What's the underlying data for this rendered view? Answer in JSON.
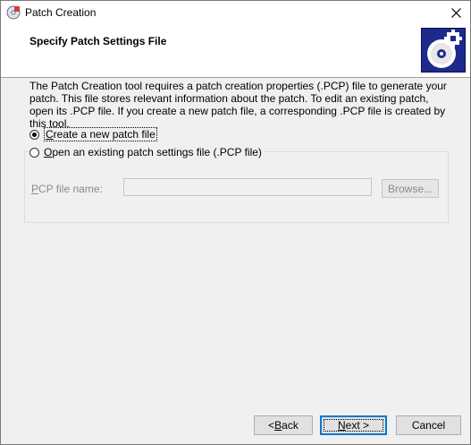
{
  "window": {
    "title": "Patch Creation"
  },
  "header": {
    "title": "Specify Patch Settings File"
  },
  "description": "The Patch Creation tool requires a patch creation properties (.PCP) file to generate your patch. This file stores relevant information about the patch. To edit an existing patch, open its .PCP file. If you create a new patch file, a corresponding .PCP file is created by this tool.",
  "options": {
    "create_new": {
      "label_mnemonic": "C",
      "label_rest": "reate a new patch file",
      "selected": true
    },
    "open_existing": {
      "label_mnemonic": "O",
      "label_rest": "pen an existing patch settings file (.PCP file)",
      "selected": false
    }
  },
  "pcp": {
    "label_mnemonic": "P",
    "label_rest": "CP file name:",
    "value": "",
    "browse_label": "Browse..."
  },
  "buttons": {
    "back_prefix": "< ",
    "back_mnemonic": "B",
    "back_rest": "ack",
    "next_mnemonic": "N",
    "next_rest": "ext >",
    "cancel": "Cancel"
  },
  "colors": {
    "logo_bg": "#1c2a8c",
    "default_button_border": "#0078d7"
  }
}
